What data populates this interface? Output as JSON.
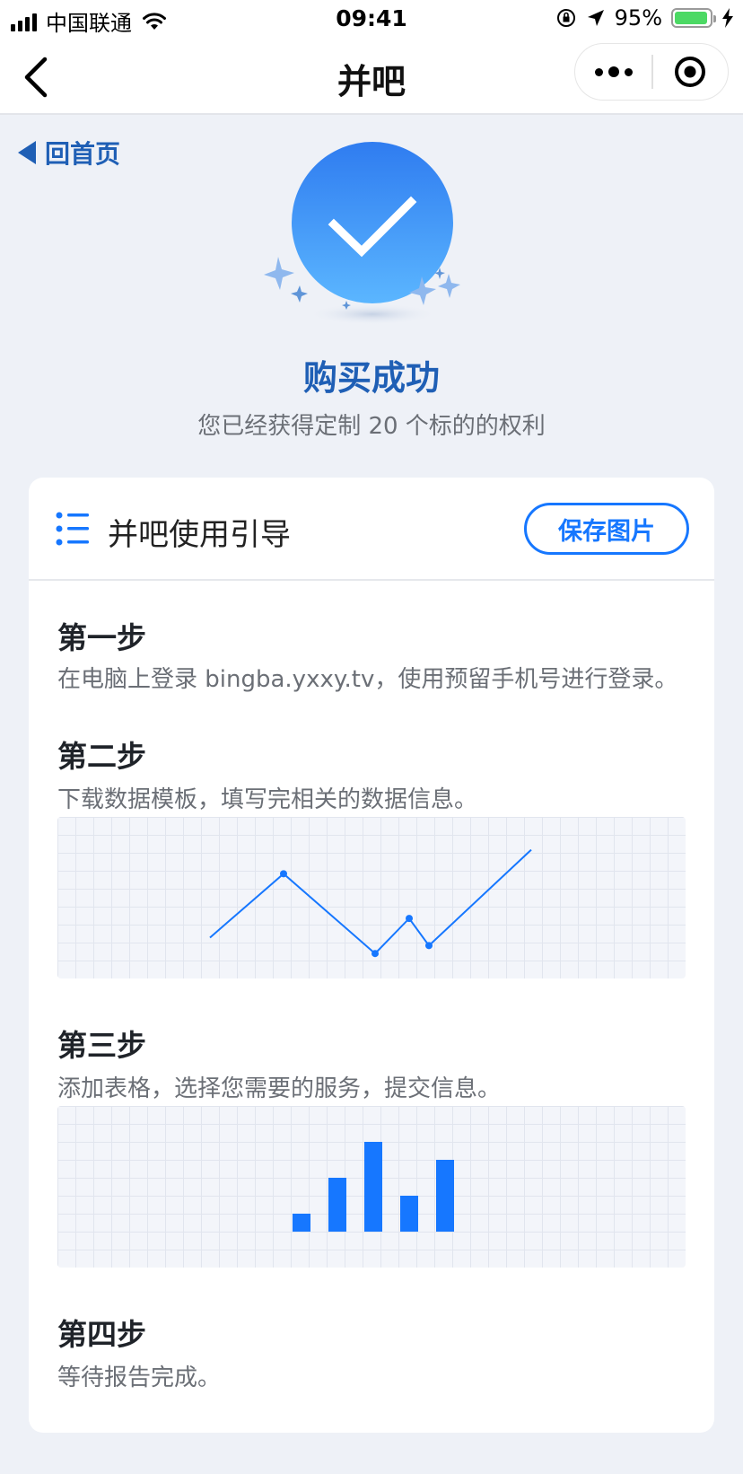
{
  "status_bar": {
    "carrier": "中国联通",
    "time": "09:41",
    "battery": "95%",
    "battery_level": 0.95
  },
  "nav": {
    "title": "并吧"
  },
  "back_home": {
    "label": "回首页"
  },
  "success": {
    "title": "购买成功",
    "subtitle": "您已经获得定制 20 个标的的权利"
  },
  "guide": {
    "title": "并吧使用引导",
    "save_label": "保存图片",
    "steps": [
      {
        "title": "第一步",
        "desc": "在电脑上登录 bingba.yxxy.tv，使用预留手机号进行登录。"
      },
      {
        "title": "第二步",
        "desc": "下载数据模板，填写完相关的数据信息。"
      },
      {
        "title": "第三步",
        "desc": "添加表格，选择您需要的服务，提交信息。"
      },
      {
        "title": "第四步",
        "desc": "等待报告完成。"
      }
    ]
  },
  "chart_data": [
    {
      "type": "line",
      "title": "",
      "x": [
        0,
        1,
        2,
        3,
        4,
        5
      ],
      "values": [
        2,
        6,
        1,
        3.2,
        1.5,
        7.5
      ],
      "markers": [
        1,
        2,
        3,
        4
      ],
      "ylim": [
        0,
        9
      ],
      "color": "#1677ff",
      "grid": true
    },
    {
      "type": "bar",
      "title": "",
      "categories": [
        "1",
        "2",
        "3",
        "4",
        "5"
      ],
      "values": [
        1,
        3,
        5,
        2,
        4
      ],
      "ylim": [
        0,
        5
      ],
      "color": "#1677ff",
      "grid": true
    }
  ],
  "colors": {
    "accent": "#1677ff",
    "link": "#1f5fb5",
    "background": "#eef1f7"
  }
}
